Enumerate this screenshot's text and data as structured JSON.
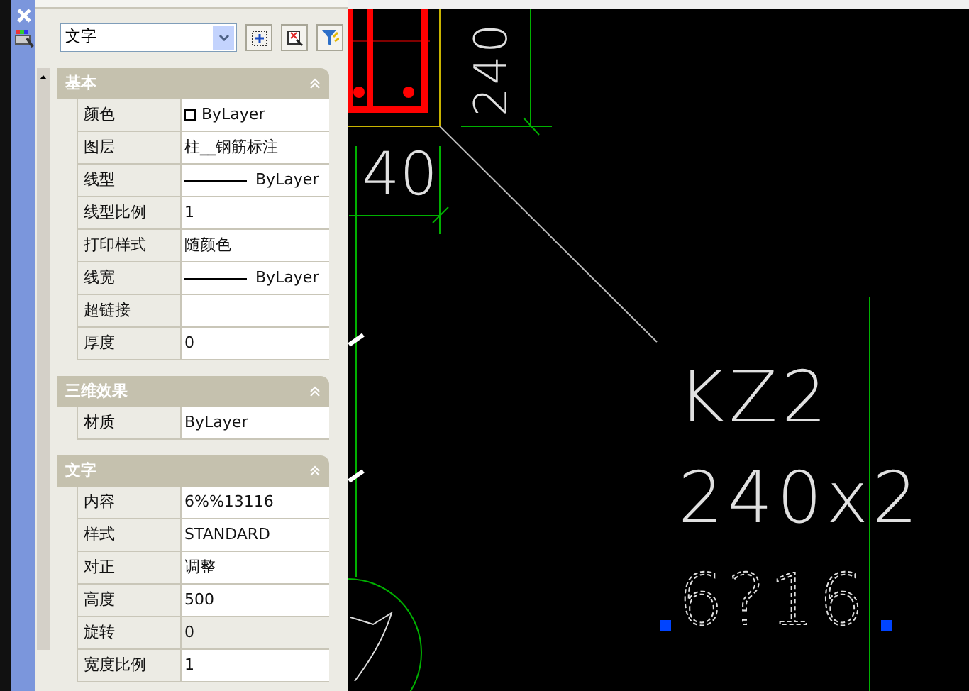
{
  "palette": {
    "object_type": "文字",
    "sections": [
      {
        "title": "基本",
        "expanded": true,
        "rows": [
          {
            "label": "颜色",
            "value": "ByLayer",
            "kind": "color",
            "highlighted": false
          },
          {
            "label": "图层",
            "value": "柱__钢筋标注",
            "kind": "text",
            "highlighted": false
          },
          {
            "label": "线型",
            "value": "ByLayer",
            "kind": "linetype",
            "highlighted": false
          },
          {
            "label": "线型比例",
            "value": "1",
            "kind": "text",
            "highlighted": false
          },
          {
            "label": "打印样式",
            "value": "随颜色",
            "kind": "text",
            "highlighted": false
          },
          {
            "label": "线宽",
            "value": "ByLayer",
            "kind": "linetype",
            "highlighted": false
          },
          {
            "label": "超链接",
            "kind": "text",
            "highlighted": false
          },
          {
            "label": "厚度",
            "value": "0",
            "kind": "text",
            "highlighted": false
          }
        ]
      },
      {
        "title": "三维效果",
        "expanded": true,
        "rows": [
          {
            "label": "材质",
            "value": "ByLayer",
            "kind": "text",
            "highlighted": false
          }
        ]
      },
      {
        "title": "文字",
        "expanded": true,
        "rows": [
          {
            "label": "内容",
            "value": "6%%13116",
            "kind": "text",
            "highlighted": false
          },
          {
            "label": "样式",
            "value": "STANDARD",
            "kind": "text",
            "highlighted": false
          },
          {
            "label": "对正",
            "value": "调整",
            "kind": "text",
            "highlighted": false
          },
          {
            "label": "高度",
            "value": "500",
            "kind": "text",
            "highlighted": false
          },
          {
            "label": "旋转",
            "value": "0",
            "kind": "text",
            "highlighted": true
          },
          {
            "label": "宽度比例",
            "value": "1",
            "kind": "text",
            "highlighted": false
          }
        ]
      }
    ]
  },
  "drawing": {
    "texts": [
      {
        "text": "240",
        "kind": "vertical",
        "selected": false
      },
      {
        "text": "40",
        "kind": "small",
        "selected": false
      },
      {
        "text": "KZ2",
        "kind": "label",
        "selected": false
      },
      {
        "text": "240x2",
        "kind": "label",
        "selected": false
      },
      {
        "text": "6?16",
        "kind": "label",
        "selected": true
      }
    ]
  }
}
